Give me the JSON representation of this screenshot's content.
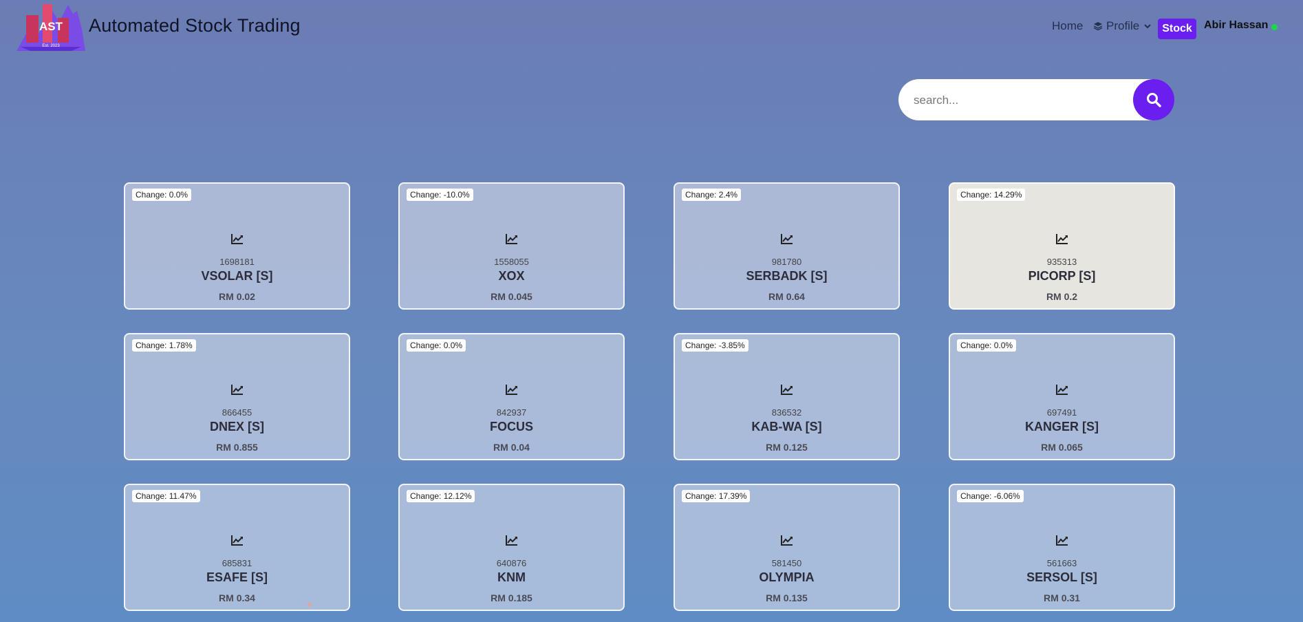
{
  "header": {
    "logo_text": "AST",
    "logo_sub": "Est. 2023",
    "title": "Automated Stock Trading",
    "nav_home": "Home",
    "nav_profile": "Profile",
    "nav_stock": "Stock",
    "user_name": "Abir Hassan"
  },
  "search": {
    "placeholder": "search..."
  },
  "colors": {
    "accent": "#6b1ef0",
    "online": "#1fd64b",
    "highlight_card": "#e7e5df"
  },
  "stocks": [
    {
      "change": "Change: 0.0%",
      "id": "1698181",
      "name": "VSOLAR [S]",
      "price": "RM 0.02"
    },
    {
      "change": "Change: -10.0%",
      "id": "1558055",
      "name": "XOX",
      "price": "RM 0.045"
    },
    {
      "change": "Change: 2.4%",
      "id": "981780",
      "name": "SERBADK [S]",
      "price": "RM 0.64"
    },
    {
      "change": "Change: 14.29%",
      "id": "935313",
      "name": "PICORP [S]",
      "price": "RM 0.2"
    },
    {
      "change": "Change: 1.78%",
      "id": "866455",
      "name": "DNEX [S]",
      "price": "RM 0.855"
    },
    {
      "change": "Change: 0.0%",
      "id": "842937",
      "name": "FOCUS",
      "price": "RM 0.04"
    },
    {
      "change": "Change: -3.85%",
      "id": "836532",
      "name": "KAB-WA [S]",
      "price": "RM 0.125"
    },
    {
      "change": "Change: 0.0%",
      "id": "697491",
      "name": "KANGER [S]",
      "price": "RM 0.065"
    },
    {
      "change": "Change: 11.47%",
      "id": "685831",
      "name": "ESAFE [S]",
      "price": "RM 0.34"
    },
    {
      "change": "Change: 12.12%",
      "id": "640876",
      "name": "KNM",
      "price": "RM 0.185"
    },
    {
      "change": "Change: 17.39%",
      "id": "581450",
      "name": "OLYMPIA",
      "price": "RM 0.135"
    },
    {
      "change": "Change: -6.06%",
      "id": "561663",
      "name": "SERSOL [S]",
      "price": "RM 0.31"
    }
  ]
}
